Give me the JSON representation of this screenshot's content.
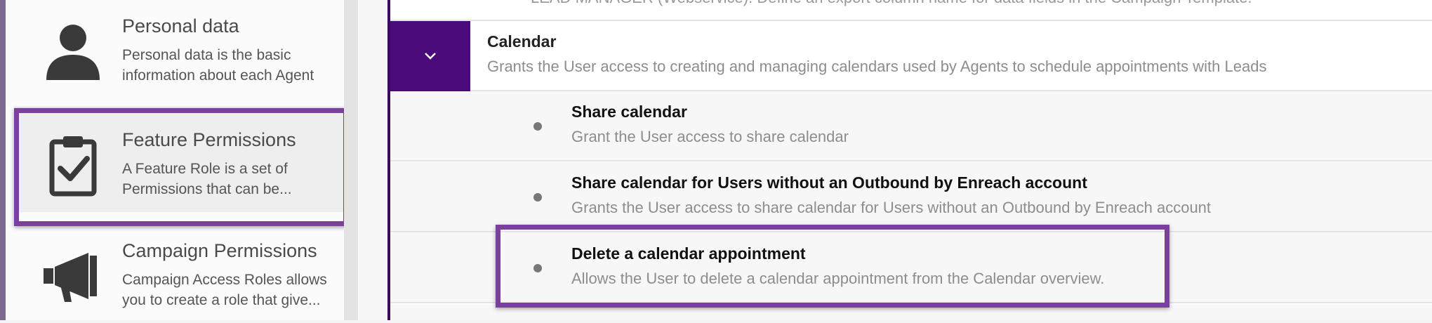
{
  "sidebar": {
    "items": [
      {
        "icon": "person-icon",
        "title": "Personal data",
        "description": "Personal data is the basic information about each Agent"
      },
      {
        "icon": "clipboard-check-icon",
        "title": "Feature Permissions",
        "description": "A Feature Role is a set of Permissions that can be..."
      },
      {
        "icon": "megaphone-icon",
        "title": "Campaign Permissions",
        "description": "Campaign Access Roles allows you to create a role that give..."
      }
    ]
  },
  "main": {
    "truncated_top_text": "LEAD MANAGER (Webservice). Define an export column name for data fields in the Campaign Template.",
    "category": {
      "title": "Calendar",
      "description": "Grants the User access to creating and managing calendars used by Agents to schedule appointments with Leads",
      "toggle_icon": "chevron-down-icon"
    },
    "permissions": [
      {
        "title": "Share calendar",
        "description": "Grant the User access to share calendar"
      },
      {
        "title": "Share calendar for Users without an Outbound by Enreach account",
        "description": "Grants the User access to share calendar for Users without an Outbound by Enreach account"
      },
      {
        "title": "Delete a calendar appointment",
        "description": "Allows the User to delete a calendar appointment from the Calendar overview."
      }
    ]
  },
  "colors": {
    "accent": "#4a0a7a",
    "highlight": "#7b3fa0"
  }
}
